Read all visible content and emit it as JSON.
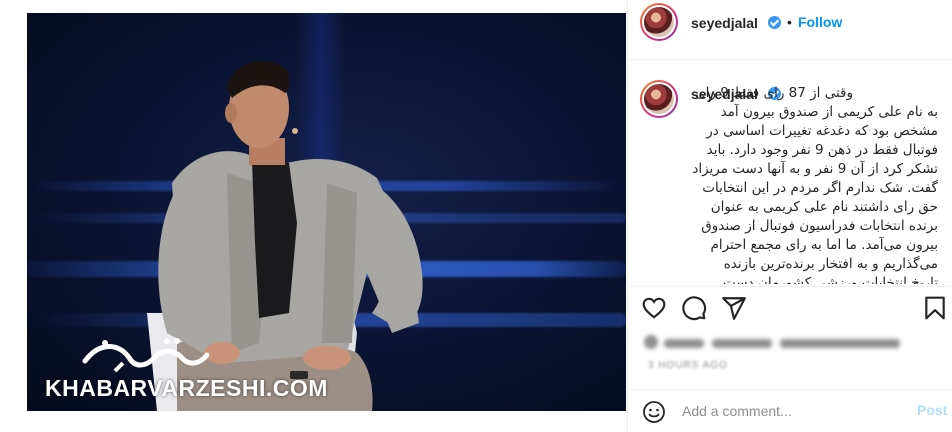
{
  "post": {
    "username": "seyedjalal",
    "follow_label": "Follow",
    "separator": "•",
    "caption_lines": [
      "وقتی از 87 رای فقط 9 رای",
      "به نام علی کریمی از صندوق بیرون آمد",
      "مشخص بود که دغدغه تغییرات اساسی در",
      "فوتبال فقط در ذهن 9 نفر وجود دارد. باید",
      "تشکر کرد از آن 9 نفر و به آنها دست مریزاد",
      "گفت. شک ندارم اگر مردم در این انتخابات",
      "حق رای داشتند نام علی کریمی به عنوان",
      "برنده انتخابات فدراسیون فوتبال از صندوق",
      "بیرون می‌آمد. ما اما به رای مجمع احترام",
      "می‌گذاریم و به افتخار برنده‌ترین بازنده",
      "تاریخ انتخابات ورزشی کشورمان دست"
    ],
    "date_blurred": "3 HOURS AGO"
  },
  "image": {
    "watermark_text": "KHABARVARZESHI.COM",
    "watermark_logo_text": "خبرورزشی"
  },
  "comment_box": {
    "placeholder": "Add a comment...",
    "post_label": "Post"
  },
  "icons": {
    "like": "heart-icon",
    "comment": "comment-icon",
    "share": "share-icon",
    "save": "bookmark-icon",
    "emoji": "emoji-icon",
    "verified": "verified-badge-icon"
  },
  "colors": {
    "link": "#0095f6",
    "verified": "#3897f0",
    "post_disabled": "#b2dffc",
    "muted": "#8e8e8e"
  }
}
